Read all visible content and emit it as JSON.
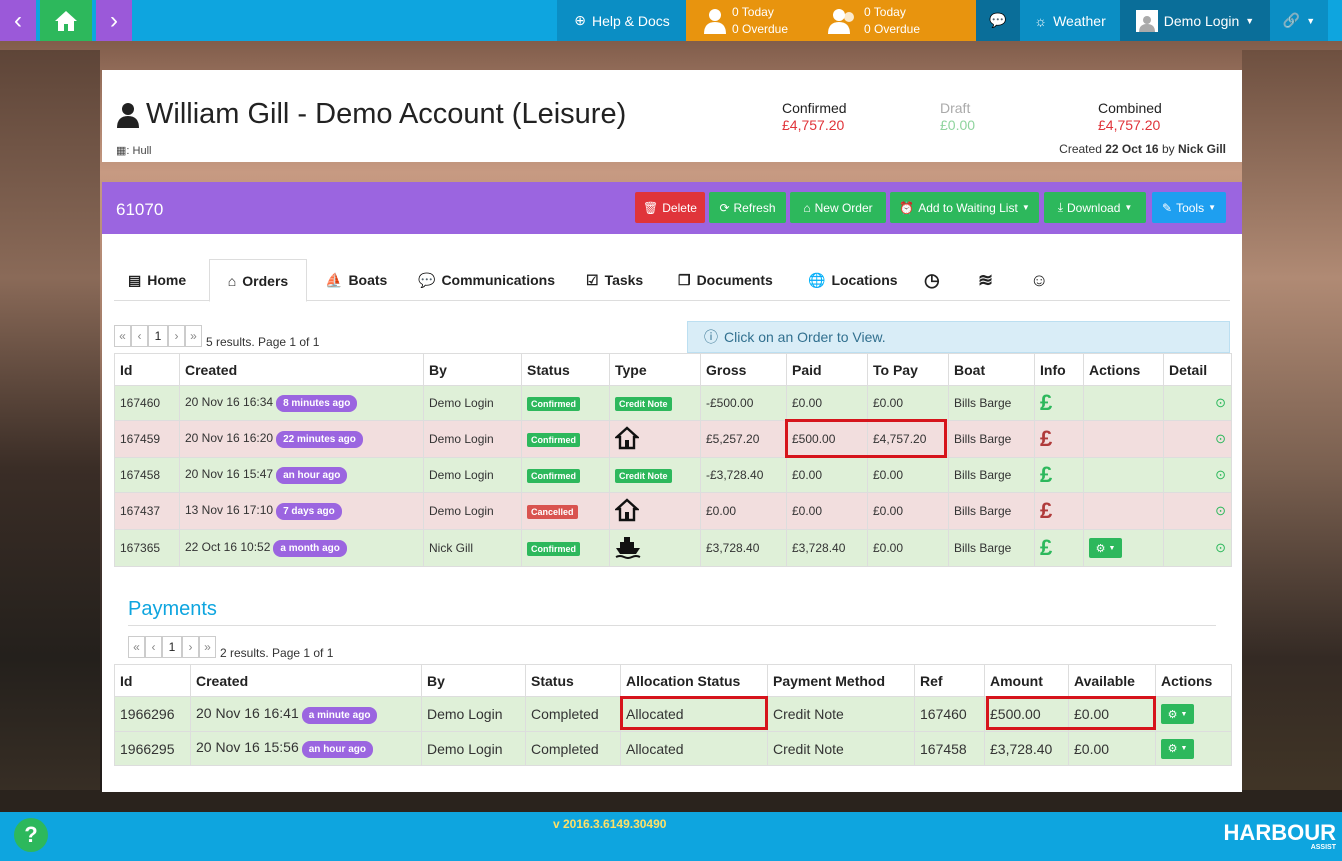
{
  "nav": {
    "help_docs": "Help & Docs",
    "tasks_today": "0 Today",
    "tasks_overdue": "0 Overdue",
    "tasks2_today": "0 Today",
    "tasks2_overdue": "0 Overdue",
    "weather": "Weather",
    "user": "Demo Login"
  },
  "account": {
    "name": "William Gill - Demo Account (Leisure)",
    "location": ": Hull",
    "confirmed_label": "Confirmed",
    "confirmed_value": "£4,757.20",
    "draft_label": "Draft",
    "draft_value": "£0.00",
    "combined_label": "Combined",
    "combined_value": "£4,757.20",
    "created_prefix": "Created",
    "created_date": "22 Oct 16",
    "created_by_word": "by",
    "created_by": "Nick Gill"
  },
  "panel": {
    "account_id": "61070",
    "buttons": {
      "delete": "Delete",
      "refresh": "Refresh",
      "new_order": "New Order",
      "waiting_list": "Add to Waiting List",
      "download": "Download",
      "tools": "Tools"
    },
    "tabs": {
      "home": "Home",
      "orders": "Orders",
      "boats": "Boats",
      "communications": "Communications",
      "tasks": "Tasks",
      "documents": "Documents",
      "locations": "Locations"
    },
    "info_text": "Click on an Order to View."
  },
  "pager": {
    "first": "«",
    "prev": "‹",
    "page": "1",
    "next": "›",
    "last": "»"
  },
  "orders": {
    "summary": "5 results. Page 1 of 1",
    "headers": [
      "Id",
      "Created",
      "By",
      "Status",
      "Type",
      "Gross",
      "Paid",
      "To Pay",
      "Boat",
      "Info",
      "Actions",
      "Detail"
    ],
    "rows": [
      {
        "id": "167460",
        "created": "20 Nov 16 16:34",
        "ago": "8 minutes ago",
        "by": "Demo Login",
        "status": "Confirmed",
        "type": "Credit Note",
        "gross": "-£500.00",
        "paid": "£0.00",
        "topay": "£0.00",
        "boat": "Bills Barge",
        "info": "£"
      },
      {
        "id": "167459",
        "created": "20 Nov 16 16:20",
        "ago": "22 minutes ago",
        "by": "Demo Login",
        "status": "Confirmed",
        "type": "home-icon",
        "gross": "£5,257.20",
        "paid": "£500.00",
        "topay": "£4,757.20",
        "boat": "Bills Barge",
        "info": "£"
      },
      {
        "id": "167458",
        "created": "20 Nov 16 15:47",
        "ago": "an hour ago",
        "by": "Demo Login",
        "status": "Confirmed",
        "type": "Credit Note",
        "gross": "-£3,728.40",
        "paid": "£0.00",
        "topay": "£0.00",
        "boat": "Bills Barge",
        "info": "£"
      },
      {
        "id": "167437",
        "created": "13 Nov 16 17:10",
        "ago": "7 days ago",
        "by": "Demo Login",
        "status": "Cancelled",
        "type": "home-icon",
        "gross": "£0.00",
        "paid": "£0.00",
        "topay": "£0.00",
        "boat": "Bills Barge",
        "info": "£"
      },
      {
        "id": "167365",
        "created": "22 Oct 16 10:52",
        "ago": "a month ago",
        "by": "Nick Gill",
        "status": "Confirmed",
        "type": "ship-icon",
        "gross": "£3,728.40",
        "paid": "£3,728.40",
        "topay": "£0.00",
        "boat": "Bills Barge",
        "info": "£"
      }
    ]
  },
  "payments": {
    "title": "Payments",
    "summary": "2 results. Page 1 of 1",
    "headers": [
      "Id",
      "Created",
      "By",
      "Status",
      "Allocation Status",
      "Payment Method",
      "Ref",
      "Amount",
      "Available",
      "Actions"
    ],
    "rows": [
      {
        "id": "1966296",
        "created": "20 Nov 16 16:41",
        "ago": "a minute ago",
        "by": "Demo Login",
        "status": "Completed",
        "alloc": "Allocated",
        "method": "Credit Note",
        "ref": "167460",
        "amount": "£500.00",
        "available": "£0.00"
      },
      {
        "id": "1966295",
        "created": "20 Nov 16 15:56",
        "ago": "an hour ago",
        "by": "Demo Login",
        "status": "Completed",
        "alloc": "Allocated",
        "method": "Credit Note",
        "ref": "167458",
        "amount": "£3,728.40",
        "available": "£0.00"
      }
    ]
  },
  "footer": {
    "version": "v 2016.3.6149.30490",
    "help": "?",
    "logo": "HARBOUR",
    "logo_sub": "ASSIST"
  },
  "colors": {
    "topbar": "#0ea5df",
    "accent_purple": "#9b65e0",
    "green": "#2db85c",
    "orange": "#e8940e",
    "red": "#e0343a"
  }
}
